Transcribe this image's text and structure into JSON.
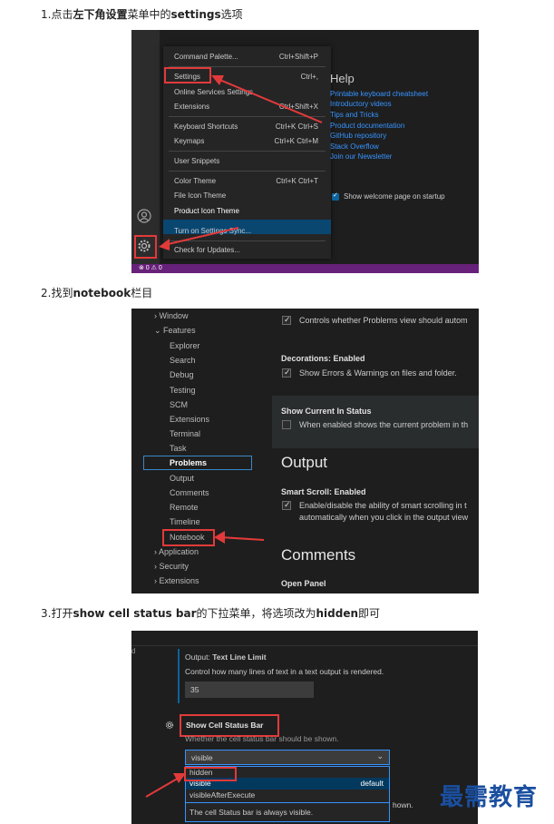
{
  "steps": {
    "s1": {
      "pre": "1.点击",
      "bold1": "左下角设置",
      "mid": "菜单中的",
      "bold2": "settings",
      "post": "选项"
    },
    "s2": {
      "pre": "2.找到",
      "bold1": "notebook",
      "post": "栏目"
    },
    "s3": {
      "pre": "3.打开",
      "bold1": "show cell status bar",
      "mid": "的下拉菜单，将选项改为",
      "bold2": "hidden",
      "post": "即可"
    }
  },
  "shot1": {
    "menu": [
      {
        "label": "Command Palette...",
        "key": "Ctrl+Shift+P"
      },
      {
        "label": "Settings",
        "key": "Ctrl+,"
      },
      {
        "label": "Online Services Settings",
        "key": ""
      },
      {
        "label": "Extensions",
        "key": "Ctrl+Shift+X"
      },
      {
        "label": "Keyboard Shortcuts",
        "key": "Ctrl+K Ctrl+S"
      },
      {
        "label": "Keymaps",
        "key": "Ctrl+K Ctrl+M"
      },
      {
        "label": "User Snippets",
        "key": ""
      },
      {
        "label": "Color Theme",
        "key": "Ctrl+K Ctrl+T"
      },
      {
        "label": "File Icon Theme",
        "key": ""
      },
      {
        "label": "Product Icon Theme",
        "key": ""
      },
      {
        "label": "Turn on Settings Sync...",
        "key": ""
      },
      {
        "label": "Check for Updates...",
        "key": ""
      }
    ],
    "help_title": "Help",
    "help_links": [
      "Printable keyboard cheatsheet",
      "Introductory videos",
      "Tips and Tricks",
      "Product documentation",
      "GitHub repository",
      "Stack Overflow",
      "Join our Newsletter"
    ],
    "startup": "Show welcome page on startup",
    "status": "⊗ 0 ⚠ 0",
    "accent": "#68217a"
  },
  "shot2": {
    "tree": {
      "window": "Window",
      "features": "Features",
      "items": [
        "Explorer",
        "Search",
        "Debug",
        "Testing",
        "SCM",
        "Extensions",
        "Terminal",
        "Task",
        "Problems",
        "Output",
        "Comments",
        "Remote",
        "Timeline",
        "Notebook"
      ],
      "after": [
        "Application",
        "Security",
        "Extensions"
      ]
    },
    "problems_desc": "Controls whether Problems view should autom",
    "decorations_title": "Decorations: Enabled",
    "decorations_desc": "Show Errors & Warnings on files and folder.",
    "current_title": "Show Current In Status",
    "current_desc": "When enabled shows the current problem in th",
    "output_heading": "Output",
    "smart_title": "Smart Scroll: Enabled",
    "smart_desc1": "Enable/disable the ability of smart scrolling in t",
    "smart_desc2": "automatically when you click in the output view",
    "comments_heading": "Comments",
    "open_panel": "Open Panel"
  },
  "shot3": {
    "letter": "d",
    "text_line_title_pre": "Output: ",
    "text_line_title": "Text Line Limit",
    "text_line_desc": "Control how many lines of text in a text output is rendered.",
    "text_line_value": "35",
    "status_bar_title": "Show Cell Status Bar",
    "status_bar_desc": "Whether the cell status bar should be shown.",
    "select_value": "visible",
    "options": [
      {
        "label": "hidden",
        "tag": ""
      },
      {
        "label": "visible",
        "tag": "default"
      },
      {
        "label": "visibleAfterExecute",
        "tag": ""
      }
    ],
    "option_desc": "The cell Status bar is always visible.",
    "trailing": "hown."
  },
  "watermark": "最需教育",
  "colors": {
    "highlight_red": "#e23a3a",
    "link_blue": "#3794ff",
    "watermark": "#1a4fa0"
  }
}
